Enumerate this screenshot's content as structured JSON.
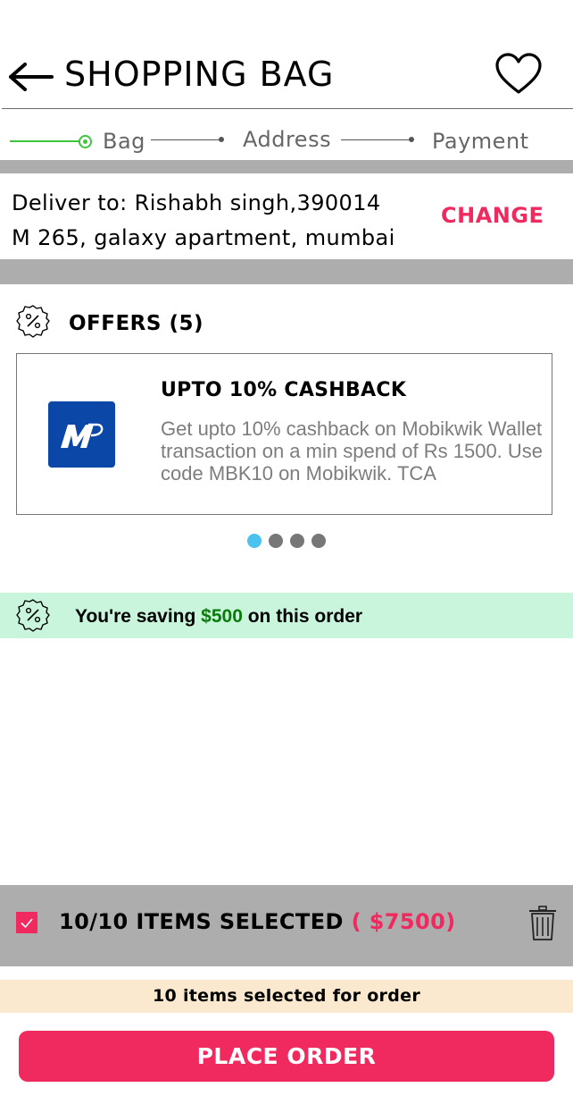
{
  "header": {
    "title": "SHOPPING BAG",
    "back_icon": "arrow-left-icon",
    "wishlist_icon": "heart-icon"
  },
  "stepper": {
    "steps": [
      {
        "label": "Bag",
        "state": "active"
      },
      {
        "label": "Address",
        "state": "pending"
      },
      {
        "label": "Payment",
        "state": "pending"
      }
    ]
  },
  "delivery": {
    "line1": "Deliver to: Rishabh singh,390014",
    "line2": "M 265, galaxy apartment, mumbai",
    "change_label": "CHANGE"
  },
  "offers": {
    "title": "OFFERS (5)",
    "icon": "percent-badge-icon",
    "card": {
      "logo": "mobikwik-logo",
      "heading": "UPTO 10% CASHBACK",
      "description": "Get upto 10% cashback on Mobikwik Wallet transaction on a min spend of Rs 1500. Use code MBK10 on Mobikwik. TCA"
    },
    "carousel": {
      "total": 4,
      "active_index": 0
    }
  },
  "savings": {
    "prefix": "You're saving ",
    "amount": "$500",
    "suffix": " on this order"
  },
  "selection": {
    "checked": true,
    "label": "10/10 ITEMS SELECTED",
    "total": " ( $7500)",
    "delete_icon": "trash-icon"
  },
  "footer": {
    "banner_text": "10 items selected for order",
    "place_order_label": "PLACE ORDER"
  },
  "colors": {
    "accent": "#f0295f",
    "active_step": "#3cc63c",
    "carousel_active": "#4cc3ef",
    "savings_bg": "#c8f5db",
    "savings_amount": "#0a7b0a",
    "band_gray": "#adadad",
    "banner_bg": "#fae9cf",
    "mobikwik_blue": "#0b47a7"
  }
}
